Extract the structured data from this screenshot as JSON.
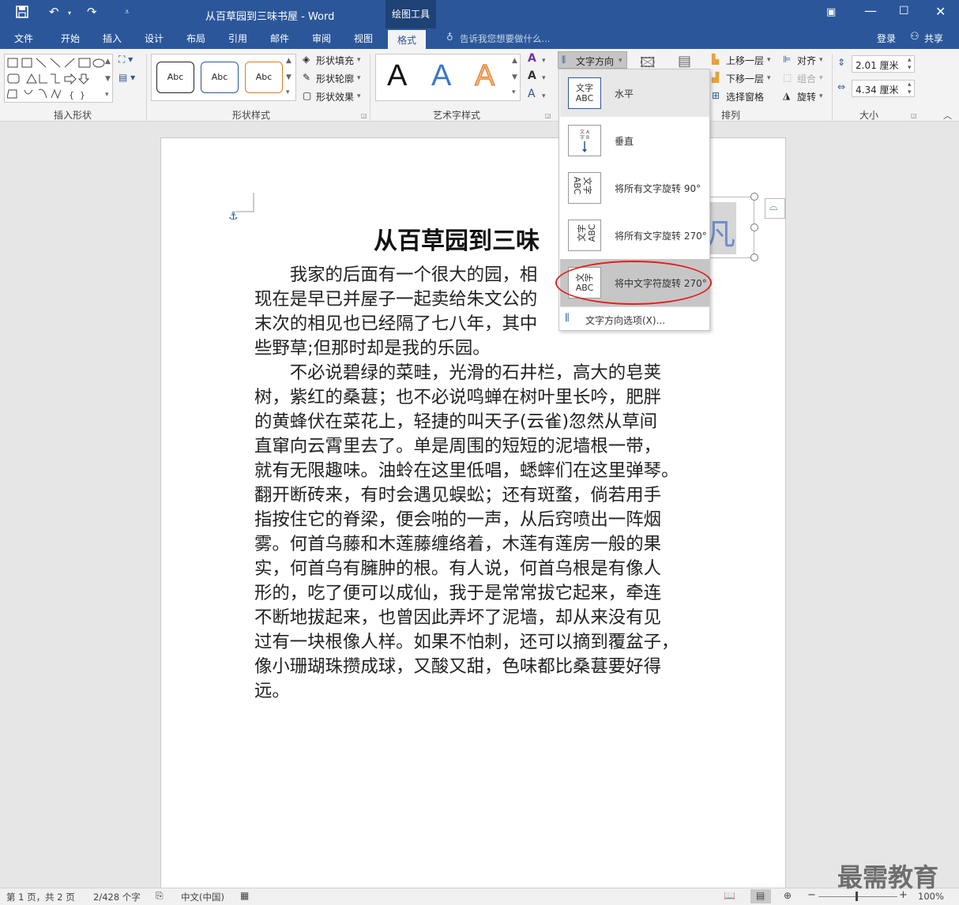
{
  "window": {
    "title": "从百草园到三味书屋 - Word",
    "context_tab": "绘图工具"
  },
  "tabs": [
    "文件",
    "开始",
    "插入",
    "设计",
    "布局",
    "引用",
    "邮件",
    "审阅",
    "视图",
    "格式"
  ],
  "tell_me": "告诉我您想要做什么...",
  "account": {
    "login": "登录",
    "share": "共享"
  },
  "ribbon": {
    "groups": {
      "insert_shapes": "插入形状",
      "shape_styles": "形状样式",
      "wordart_styles": "艺术字样式",
      "arrange": "排列",
      "size": "大小"
    },
    "style_samples": [
      "Abc",
      "Abc",
      "Abc"
    ],
    "shape_fill": "形状填充",
    "shape_outline": "形状轮廓",
    "shape_effects": "形状效果",
    "wordart_letters": [
      "A",
      "A",
      "A"
    ],
    "text_direction": "文字方向",
    "bring_forward": "上移一层",
    "send_backward": "下移一层",
    "selection_pane": "选择窗格",
    "align": "对齐",
    "group": "组合",
    "rotate": "旋转",
    "height": "2.01 厘米",
    "width": "4.34 厘米"
  },
  "dropdown": {
    "items": [
      {
        "label": "水平",
        "icon": "文字\nABC"
      },
      {
        "label": "垂直",
        "icon": "vertical"
      },
      {
        "label": "将所有文字旋转 90°",
        "icon": "rot90"
      },
      {
        "label": "将所有文字旋转 270°",
        "icon": "rot270"
      },
      {
        "label": "将中文字符旋转 270°",
        "icon": "cjk270"
      }
    ],
    "options": "文字方向选项(X)..."
  },
  "document": {
    "title": "从百草园到三味",
    "lines": [
      "　　我家的后面有一个很大的园，相",
      "现在是早已并屋子一起卖给朱文公的",
      "末次的相见也已经隔了七八年，其中",
      "些野草;但那时却是我的乐园。",
      "　　不必说碧绿的菜畦，光滑的石井栏，高大的皂荚",
      "树，紫红的桑葚；也不必说鸣蝉在树叶里长吟，肥胖",
      "的黄蜂伏在菜花上，轻捷的叫天子(云雀)忽然从草间",
      "直窜向云霄里去了。单是周围的短短的泥墙根一带，",
      "就有无限趣味。油蛉在这里低唱，蟋蟀们在这里弹琴。",
      "翻开断砖来，有时会遇见蜈蚣；还有斑蝥，倘若用手",
      "指按住它的脊梁，便会啪的一声，从后窍喷出一阵烟",
      "雾。何首乌藤和木莲藤缠络着，木莲有莲房一般的果",
      "实，何首乌有臃肿的根。有人说，何首乌根是有像人",
      "形的，吃了便可以成仙，我于是常常拔它起来，牵连",
      "不断地拔起来，也曾因此弄坏了泥墙，却从来没有见",
      "过有一块根像人样。如果不怕刺，还可以摘到覆盆子，",
      "像小珊瑚珠攒成球，又酸又甜，色味都比桑葚要好得",
      "远。"
    ]
  },
  "status": {
    "page": "第 1 页，共 2 页",
    "words": "2/428 个字",
    "lang": "中文(中国)",
    "zoom": "100%"
  },
  "watermark": "最需教育",
  "colors": {
    "accent": "#2b579a",
    "highlight_circle": "#e02020"
  }
}
